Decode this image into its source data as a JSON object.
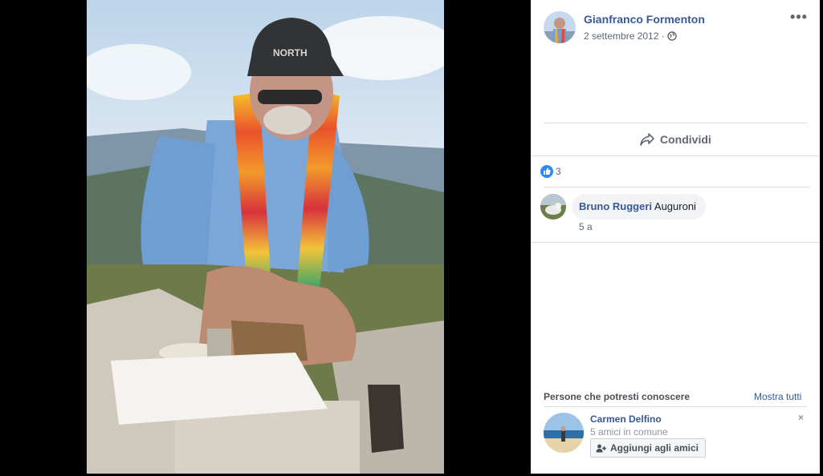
{
  "post": {
    "author": "Gianfranco Formenton",
    "date": "2 settembre 2012 ·",
    "audience_icon": "globe-icon",
    "more_icon": "•••"
  },
  "actions": {
    "share_label": "Condividi",
    "share_icon": "share-arrow-icon"
  },
  "reactions": {
    "like_count": "3",
    "icon": "thumbs-up-icon",
    "color": "#2d88ff"
  },
  "comments": [
    {
      "author": "Bruno Ruggeri",
      "text": "Auguroni",
      "time": "5 a"
    }
  ],
  "pymk": {
    "title": "Persone che potresti conoscere",
    "see_all": "Mostra tutti",
    "close": "×",
    "people": [
      {
        "name": "Carmen Delfino",
        "mutual": "5 amici in comune",
        "add_label": "Aggiungi agli amici"
      }
    ]
  },
  "colors": {
    "link": "#385898",
    "secondary": "#606770",
    "divider": "#dadde1"
  }
}
